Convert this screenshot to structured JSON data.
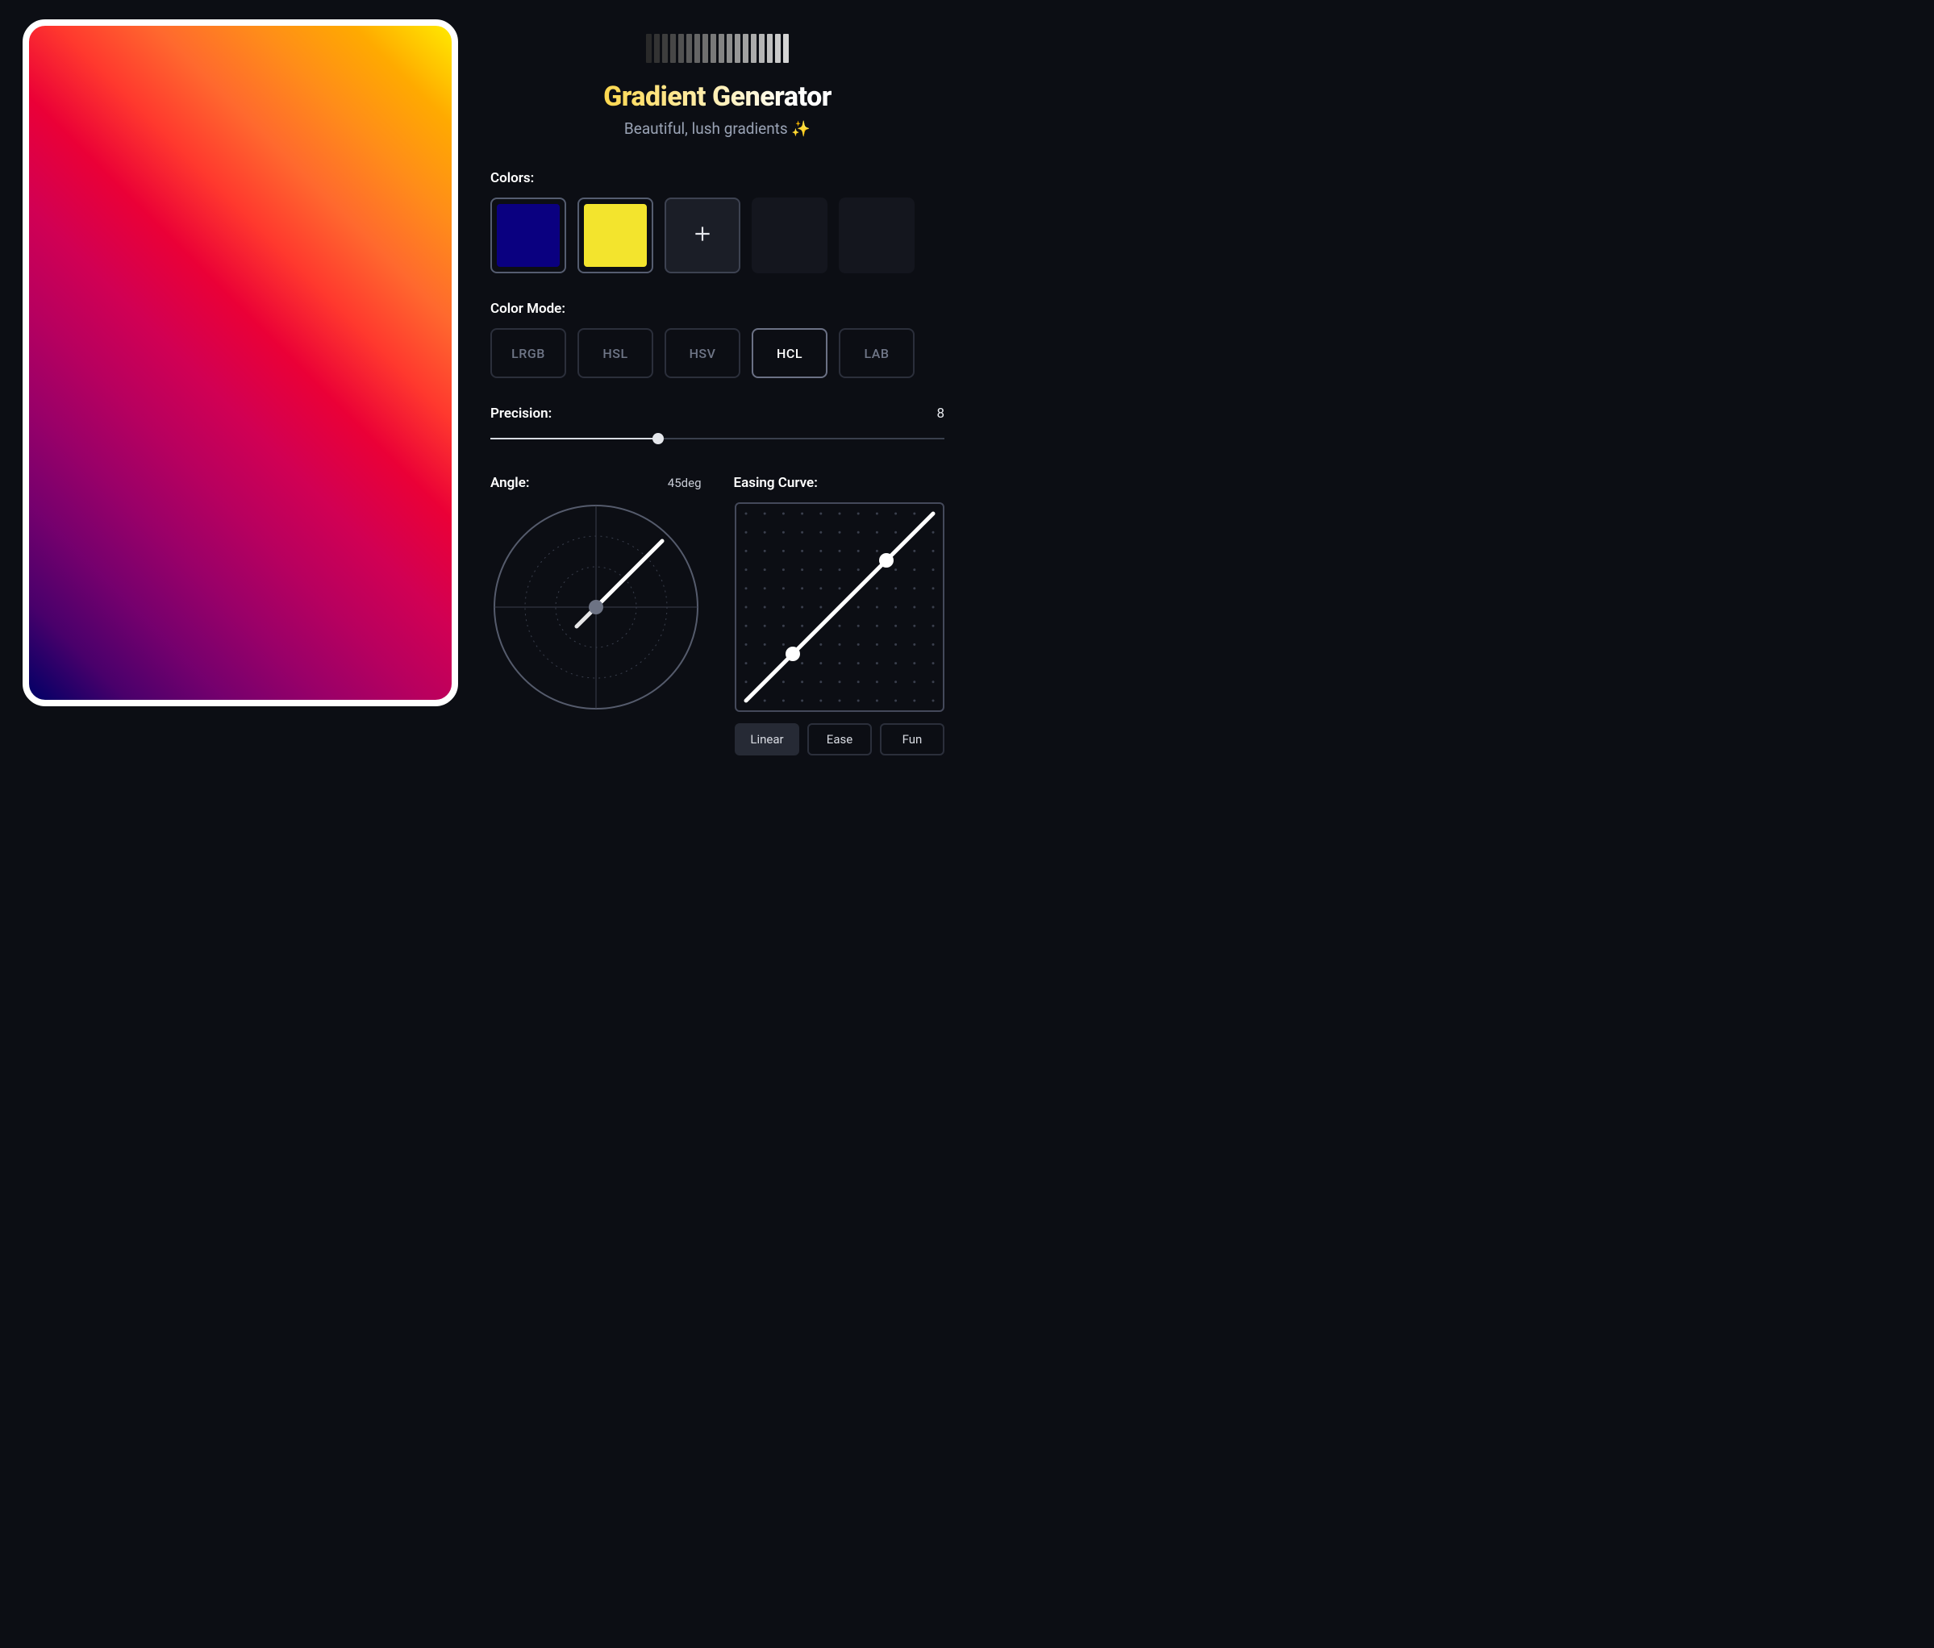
{
  "header": {
    "title": "Gradient Generator",
    "subtitle": "Beautiful, lush gradients ✨"
  },
  "colors": {
    "label": "Colors:",
    "swatches": [
      "#0a0080",
      "#f3e42d"
    ]
  },
  "color_mode": {
    "label": "Color Mode:",
    "options": [
      "LRGB",
      "HSL",
      "HSV",
      "HCL",
      "LAB"
    ],
    "selected": "HCL"
  },
  "precision": {
    "label": "Precision:",
    "value": 8,
    "min": 1,
    "max": 20,
    "percent": 37
  },
  "angle": {
    "label": "Angle:",
    "value": "45deg",
    "degrees": 45
  },
  "easing": {
    "label": "Easing Curve:",
    "presets": [
      "Linear",
      "Ease",
      "Fun"
    ],
    "selected": "Linear",
    "control_points": [
      [
        0.25,
        0.25
      ],
      [
        0.75,
        0.75
      ]
    ]
  }
}
